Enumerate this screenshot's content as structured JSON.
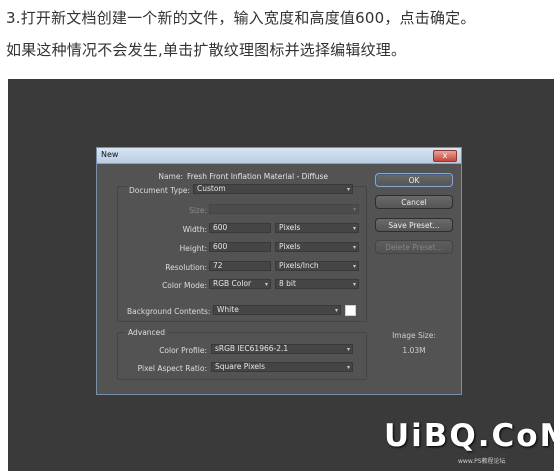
{
  "instructions": {
    "line1": "3.打开新文档创建一个新的文件，输入宽度和高度值600，点击确定。",
    "line2": "如果这种情况不会发生,单击扩散纹理图标并选择编辑纹理。"
  },
  "dialog": {
    "title": "New",
    "close_label": "x",
    "name_label": "Name:",
    "name_value": "Fresh Front Inflation Material - Diffuse",
    "document_type_label": "Document Type:",
    "document_type_value": "Custom",
    "size_label": "Size:",
    "width_label": "Width:",
    "width_value": "600",
    "width_unit": "Pixels",
    "height_label": "Height:",
    "height_value": "600",
    "height_unit": "Pixels",
    "resolution_label": "Resolution:",
    "resolution_value": "72",
    "resolution_unit": "Pixels/Inch",
    "color_mode_label": "Color Mode:",
    "color_mode_value": "RGB Color",
    "bit_depth_value": "8 bit",
    "background_label": "Background Contents:",
    "background_value": "White",
    "background_color": "#ffffff",
    "advanced_label": "Advanced",
    "color_profile_label": "Color Profile:",
    "color_profile_value": "sRGB IEC61966-2.1",
    "pixel_aspect_label": "Pixel Aspect Ratio:",
    "pixel_aspect_value": "Square Pixels",
    "buttons": {
      "ok": "OK",
      "cancel": "Cancel",
      "save_preset": "Save Preset...",
      "delete_preset": "Delete Preset..."
    },
    "image_size_label": "Image Size:",
    "image_size_value": "1.03M"
  },
  "watermark": {
    "main": "UiBQ.CoM",
    "sub": "www.PS教程论坛"
  },
  "colors": {
    "canvas": "#3a3a3a",
    "dialog_bg": "#535353",
    "titlebar": "#c8d8ea"
  }
}
